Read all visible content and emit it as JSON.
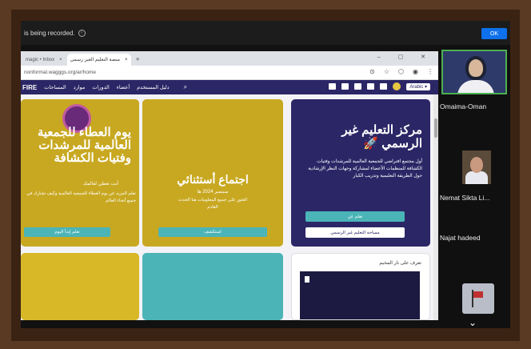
{
  "recording": {
    "text": "is being recorded.",
    "info_icon": "i",
    "ok_label": "OK"
  },
  "browser": {
    "tabs": [
      {
        "label": "magic • Inbox",
        "close": "×"
      },
      {
        "label": "منصة التعليم الغير رسمي",
        "close": "×"
      }
    ],
    "new_tab": "+",
    "window_controls": "– ▢ ✕",
    "url": "nonformal.wagggs.org/ar/home",
    "icons": [
      "⊙",
      "☆",
      "⬡",
      "◉",
      "⋮"
    ]
  },
  "site_nav": {
    "logo": "FIRE",
    "items": [
      "المساحات",
      "موارد",
      "الدورات",
      "أعضاء",
      "دليل المستخدم"
    ],
    "search_icon": "⌕",
    "language": "Arabic ▾"
  },
  "cards": {
    "a": {
      "title": "يوم العطاء للجمعية العالمية للمرشدات وفتيات الكشافة",
      "subtitle": "أنت تعطي لعالمك",
      "desc": "تعلم المزيد عن يوم العطاء للجمعية العالمية وكيف تشارك في جميع أنحاء العالم",
      "button": "تعلم إبدأ اليوم"
    },
    "b": {
      "title": "اجتماع أستثنائي",
      "date": "سبتمبر 2024 ها",
      "desc": "العثور على جميع المعلومات هنا الحدث القادم",
      "button": "استكشف"
    },
    "c": {
      "title": "مركز التعليم غير الرسمي",
      "rocket": "🚀",
      "desc": "أول مجتمع افتراضي للجمعية العالمية للمرشدات وفتيات الكشافة للمنظمات الأعضاء لمشاركة وجهات النظر الإرشادية حول الطريقة التعليمية وتدريب الكبار",
      "button1": "تعلم عن",
      "button2": "مساحة التعليم غير الرسمي"
    },
    "f": {
      "title": "تعرف على نار المخيم"
    }
  },
  "participants": [
    {
      "name": "Omaima-Oman"
    },
    {
      "name": "Nemat Sikta  Li..."
    },
    {
      "name": "Najat hadeed"
    }
  ],
  "panel": {
    "expand_icon": "⌄"
  }
}
